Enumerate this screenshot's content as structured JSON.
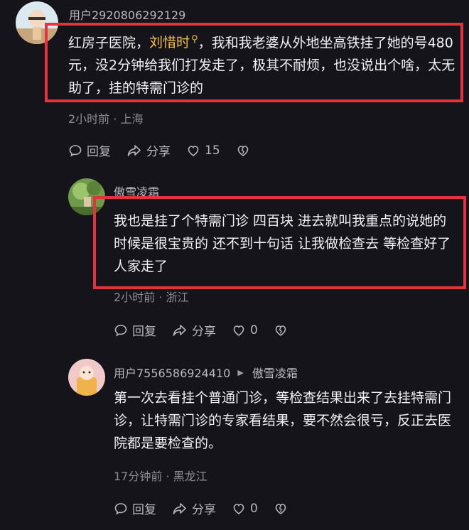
{
  "comments": [
    {
      "username": "用户2920806292129",
      "text_before": "红房子医院，",
      "mention": "刘惜时",
      "text_after": "，我和我老婆从外地坐高铁挂了她的号480元，没2分钟给我们打发走了，极其不耐烦，也没说出个啥，太无助了，挂的特需门诊的",
      "time": "2小时前",
      "location": "上海",
      "reply_label": "回复",
      "share_label": "分享",
      "like_count": "15"
    },
    {
      "username": "傲雪凌霜",
      "text": "我也是挂了个特需门诊 四百块 进去就叫我重点的说她的时候是很宝贵的 还不到十句话 让我做检查去 等检查好了 人家走了",
      "time": "2小时前",
      "location": "浙江",
      "reply_label": "回复",
      "share_label": "分享",
      "like_count": "0"
    },
    {
      "username": "用户7556586924410",
      "reply_to": "傲雪凌霜",
      "text": "第一次去看挂个普通门诊，等检查结果出来了去挂特需门诊，让特需门诊的专家看结果，要不然会很亏，反正去医院都是要检查的。",
      "time": "17分钟前",
      "location": "黑龙江",
      "reply_label": "回复",
      "share_label": "分享",
      "like_count": "0"
    }
  ],
  "separator": " · ",
  "colors": {
    "background": "#15141a",
    "highlight_border": "#e5333d",
    "mention": "#f1c24a"
  }
}
